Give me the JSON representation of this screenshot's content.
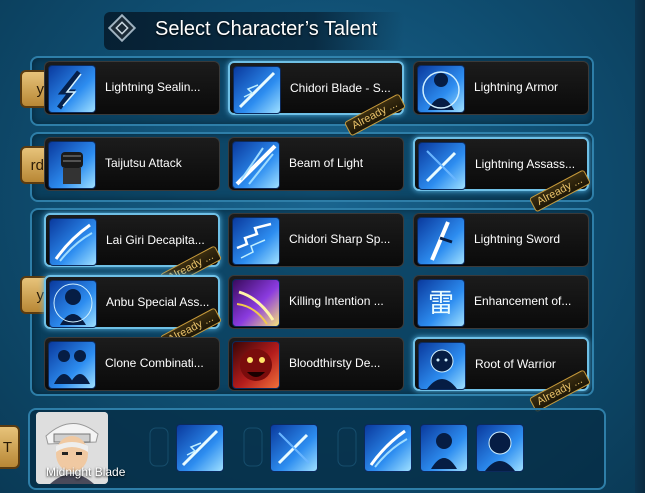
{
  "title": "Select Character’s Talent",
  "left_tabs": [
    "y",
    "rd",
    "y",
    "T"
  ],
  "badge_text": "Already ...",
  "rows": [
    {
      "cards": [
        {
          "label": "Lightning Sealin...",
          "selected": false,
          "already": false
        },
        {
          "label": "Chidori Blade - S...",
          "selected": true,
          "already": true
        },
        {
          "label": "Lightning Armor",
          "selected": false,
          "already": false
        }
      ]
    },
    {
      "cards": [
        {
          "label": "Taijutsu Attack",
          "selected": false,
          "already": false
        },
        {
          "label": "Beam of Light",
          "selected": false,
          "already": false
        },
        {
          "label": "Lightning Assass...",
          "selected": true,
          "already": true
        }
      ]
    },
    {
      "cards": [
        {
          "label": "Lai Giri Decapita...",
          "selected": true,
          "already": true
        },
        {
          "label": "Chidori Sharp Sp...",
          "selected": false,
          "already": false
        },
        {
          "label": "Lightning Sword",
          "selected": false,
          "already": false
        }
      ]
    },
    {
      "cards": [
        {
          "label": "Anbu Special Ass...",
          "selected": true,
          "already": true
        },
        {
          "label": "Killing Intention ...",
          "selected": false,
          "already": false
        },
        {
          "label": "Enhancement of...",
          "selected": false,
          "already": false
        }
      ]
    },
    {
      "cards": [
        {
          "label": "Clone Combinati...",
          "selected": false,
          "already": false
        },
        {
          "label": "Bloodthirsty De...",
          "selected": false,
          "already": false
        },
        {
          "label": "Root of Warrior",
          "selected": true,
          "already": true
        }
      ]
    }
  ],
  "character": {
    "name": "Midnight Blade"
  },
  "equipped_slots": [
    "chidori-blade-icon",
    "lightning-assassin-icon",
    "lai-giri-icon",
    "anbu-special-icon",
    "root-of-warrior-icon"
  ]
}
